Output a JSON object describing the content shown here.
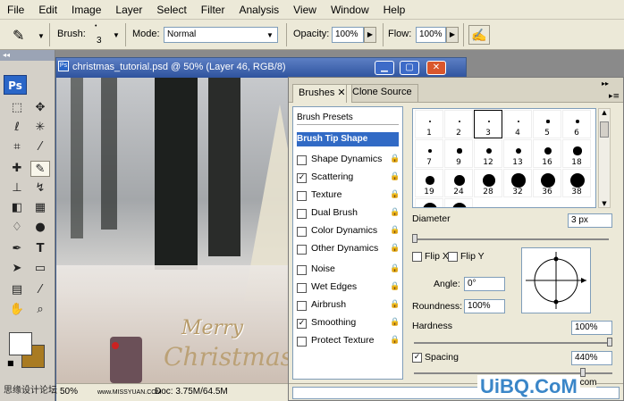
{
  "menu": [
    "File",
    "Edit",
    "Image",
    "Layer",
    "Select",
    "Filter",
    "Analysis",
    "View",
    "Window",
    "Help"
  ],
  "options": {
    "brush_label": "Brush:",
    "brush_size": "3",
    "mode_label": "Mode:",
    "mode_value": "Normal",
    "opacity_label": "Opacity:",
    "opacity_value": "100%",
    "flow_label": "Flow:",
    "flow_value": "100%"
  },
  "toolbox": {
    "logo": "Ps"
  },
  "document": {
    "title": "christmas_tutorial.psd @ 50% (Layer 46, RGB/8)",
    "zoom": "50%",
    "doc_info": "Doc: 3.75M/64.5M",
    "canvas_text_1": "Merry",
    "canvas_text_2": "Christmas"
  },
  "brushes_panel": {
    "tabs": [
      "Brushes",
      "Clone Source"
    ],
    "presets_label": "Brush Presets",
    "selected_section": "Brush Tip Shape",
    "options": [
      {
        "label": "Shape Dynamics",
        "checked": false
      },
      {
        "label": "Scattering",
        "checked": true
      },
      {
        "label": "Texture",
        "checked": false
      },
      {
        "label": "Dual Brush",
        "checked": false
      },
      {
        "label": "Color Dynamics",
        "checked": false
      },
      {
        "label": "Other Dynamics",
        "checked": false
      },
      {
        "label": "Noise",
        "checked": false
      },
      {
        "label": "Wet Edges",
        "checked": false
      },
      {
        "label": "Airbrush",
        "checked": false
      },
      {
        "label": "Smoothing",
        "checked": true
      },
      {
        "label": "Protect Texture",
        "checked": false
      }
    ],
    "brush_sizes": [
      "1",
      "2",
      "3",
      "4",
      "5",
      "6",
      "7",
      "9",
      "12",
      "13",
      "16",
      "18",
      "19",
      "24",
      "28",
      "32",
      "36",
      "38"
    ],
    "selected_brush": "3",
    "diameter_label": "Diameter",
    "diameter_value": "3 px",
    "flip_x": "Flip X",
    "flip_y": "Flip Y",
    "angle_label": "Angle:",
    "angle_value": "0°",
    "roundness_label": "Roundness:",
    "roundness_value": "100%",
    "hardness_label": "Hardness",
    "hardness_value": "100%",
    "spacing_label": "Spacing",
    "spacing_value": "440%"
  },
  "watermarks": {
    "left": "思缘设计论坛",
    "url": "www.MISSYUAN.COM",
    "site": "www.Alfoart.com",
    "logo": "UiBQ.CoM"
  }
}
